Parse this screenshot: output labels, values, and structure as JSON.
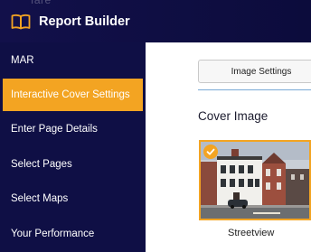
{
  "header": {
    "title": "Report Builder",
    "ghost_text": "fare",
    "icon": "open-book-icon"
  },
  "sidebar": {
    "items": [
      {
        "label": "MAR",
        "active": false
      },
      {
        "label": "Interactive Cover Settings",
        "active": true
      },
      {
        "label": "Enter Page Details",
        "active": false
      },
      {
        "label": "Select Pages",
        "active": false
      },
      {
        "label": "Select Maps",
        "active": false
      },
      {
        "label": "Your Performance",
        "active": false
      }
    ]
  },
  "main": {
    "tab_button": "Image Settings",
    "section_title": "Cover Image",
    "cover_option": {
      "caption": "Streetview",
      "selected": true,
      "icon": "check-icon"
    }
  },
  "colors": {
    "header_bg": "#12104a",
    "sidebar_bg": "#0f0f45",
    "accent": "#f3a422"
  }
}
